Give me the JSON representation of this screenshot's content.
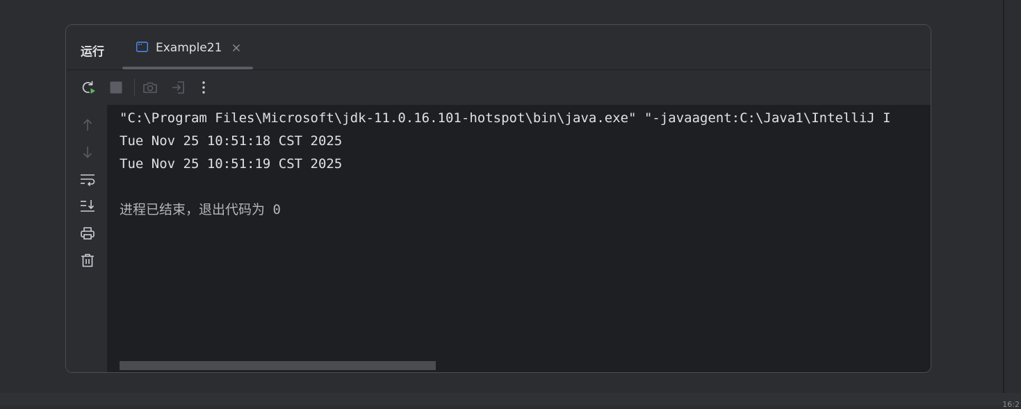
{
  "panel": {
    "title": "运行",
    "tab": {
      "label": "Example21",
      "icon": "console-window-icon",
      "close_icon": "close-icon"
    }
  },
  "toolbar": {
    "buttons": [
      {
        "name": "rerun-button",
        "icon": "rerun-icon",
        "enabled": true
      },
      {
        "name": "stop-button",
        "icon": "stop-icon",
        "enabled": false
      },
      {
        "name": "screenshot-button",
        "icon": "camera-icon",
        "enabled": false
      },
      {
        "name": "attach-debugger-button",
        "icon": "exit-icon",
        "enabled": false
      },
      {
        "name": "more-options-button",
        "icon": "more-vertical-icon",
        "enabled": true
      }
    ]
  },
  "gutter": {
    "buttons": [
      {
        "name": "previous-occurrence-button",
        "icon": "arrow-up-icon",
        "enabled": false
      },
      {
        "name": "next-occurrence-button",
        "icon": "arrow-down-icon",
        "enabled": false
      },
      {
        "name": "soft-wrap-button",
        "icon": "soft-wrap-icon",
        "enabled": true
      },
      {
        "name": "scroll-to-end-button",
        "icon": "scroll-to-end-icon",
        "enabled": true
      },
      {
        "name": "print-button",
        "icon": "printer-icon",
        "enabled": true
      },
      {
        "name": "clear-all-button",
        "icon": "trash-icon",
        "enabled": true
      }
    ]
  },
  "console": {
    "lines": [
      "\"C:\\Program Files\\Microsoft\\jdk-11.0.16.101-hotspot\\bin\\java.exe\" \"-javaagent:C:\\Java1\\IntelliJ I",
      "Tue Nov 25 10:51:18 CST 2025",
      "Tue Nov 25 10:51:19 CST 2025",
      "",
      "进程已结束，退出代码为 0"
    ],
    "exit_message_color": "#b4b6ba"
  },
  "status_bar": {
    "text": "16:2"
  },
  "colors": {
    "background": "#2b2d30",
    "console_bg": "#1e1f22",
    "text": "#dfe1e5",
    "icon": "#ced0d6",
    "icon_disabled": "#5a5d63",
    "run_green": "#5fb865",
    "tab_icon_blue": "#548af7"
  }
}
